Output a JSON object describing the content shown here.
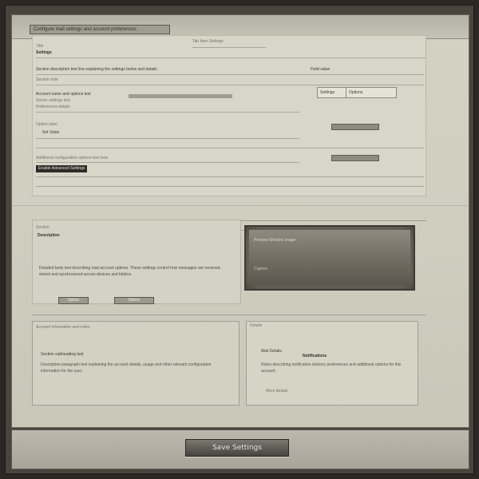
{
  "topbar": {
    "text": "Configure mail settings and account preferences"
  },
  "top_panel": {
    "header_small": "Title",
    "header_center": "Tab   Item   Settings",
    "section_title": "Settings",
    "line_1": "Section description text line explaining the settings below and details",
    "line_1_right": "Field value",
    "line_2": "Section note",
    "row_a_label": "Account name and options text",
    "row_a_sub": "Server settings text",
    "row_a_sub2": "Preferences details",
    "row_b_label": "Option label",
    "row_b_value": "Set Value",
    "row_c_label": "Additional configuration options text here",
    "dark_chip": "Enable Advanced Settings",
    "fields": {
      "left": "Settings",
      "right": "Options"
    },
    "chip_a": "",
    "chip_b": ""
  },
  "left_panel": {
    "title": "Section",
    "subtitle": "Description",
    "body": "Detailed body text describing mail account options. These settings control how messages are received, stored and synchronized across devices and folders.",
    "btn_a": "Option",
    "btn_b": "Option"
  },
  "preview": {
    "title": "Preview Window Image",
    "caption": "Caption"
  },
  "low_left": {
    "heading": "Account information and notes",
    "sub": "Section subheading text",
    "body": "Descriptive paragraph text explaining the account details, usage and other relevant configuration information for the user."
  },
  "low_right": {
    "heading": "Details",
    "title": "Mail Details",
    "subtitle": "Notifications",
    "body": "Notes describing notification delivery preferences and additional options for this account.",
    "foot": "More details"
  },
  "bottom": {
    "save_label": "Save Settings"
  }
}
